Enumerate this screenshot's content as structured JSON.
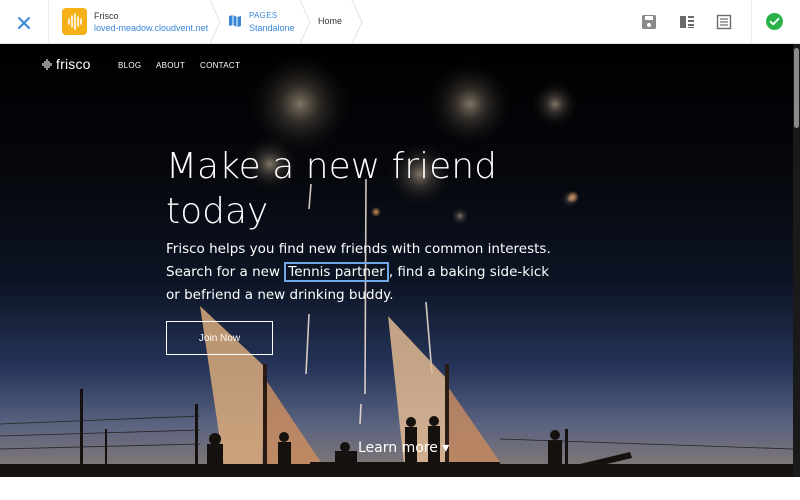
{
  "toolbar": {
    "site_name": "Frisco",
    "site_domain": "loved-meadow.cloudvent.net",
    "pages_label": "PAGES",
    "pages_value": "Standalone",
    "breadcrumb_home": "Home",
    "icons": [
      "close-icon",
      "site-logo",
      "map-icon",
      "save-icon",
      "columns-icon",
      "list-icon",
      "check-icon"
    ],
    "accent": "#3a86d8",
    "logo_color": "#f5b117",
    "ok_color": "#2ab24a"
  },
  "site": {
    "logo": "frisco",
    "nav": [
      "BLOG",
      "ABOUT",
      "CONTACT"
    ],
    "headline_line1": "Make a new friend",
    "headline_line2": "today",
    "blurb_before": "Frisco helps you find new friends with common interests. Search for a new ",
    "blurb_highlight": "Tennis partner",
    "blurb_after": ", find a baking side-kick or befriend a new drinking buddy.",
    "cta": "Join Now",
    "learn_more": "Learn more ▾",
    "highlight_color": "#6fa7e9"
  }
}
